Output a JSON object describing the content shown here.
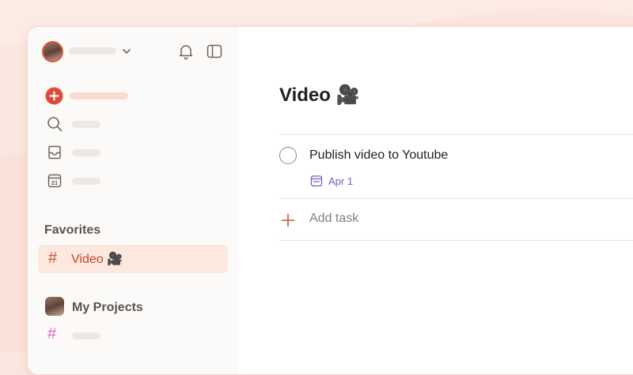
{
  "sidebar": {
    "favorites_title": "Favorites",
    "favorite_item": {
      "label": "Video",
      "emoji": "🎥"
    },
    "projects_title": "My Projects",
    "colors": {
      "accent": "#dc4c3e",
      "project_hash": "#e06ec0"
    }
  },
  "icons": {
    "top": [
      "avatar",
      "chevron-down-icon",
      "bell-icon",
      "sidebar-toggle-icon"
    ],
    "nav": [
      "add-circle-icon",
      "search-icon",
      "inbox-icon",
      "calendar-icon"
    ]
  },
  "calendar_icon_day": "21",
  "main": {
    "title": "Video",
    "title_emoji": "🎥",
    "task": {
      "name": "Publish video to Youtube",
      "due": "Apr 1"
    },
    "add_task_label": "Add task"
  }
}
